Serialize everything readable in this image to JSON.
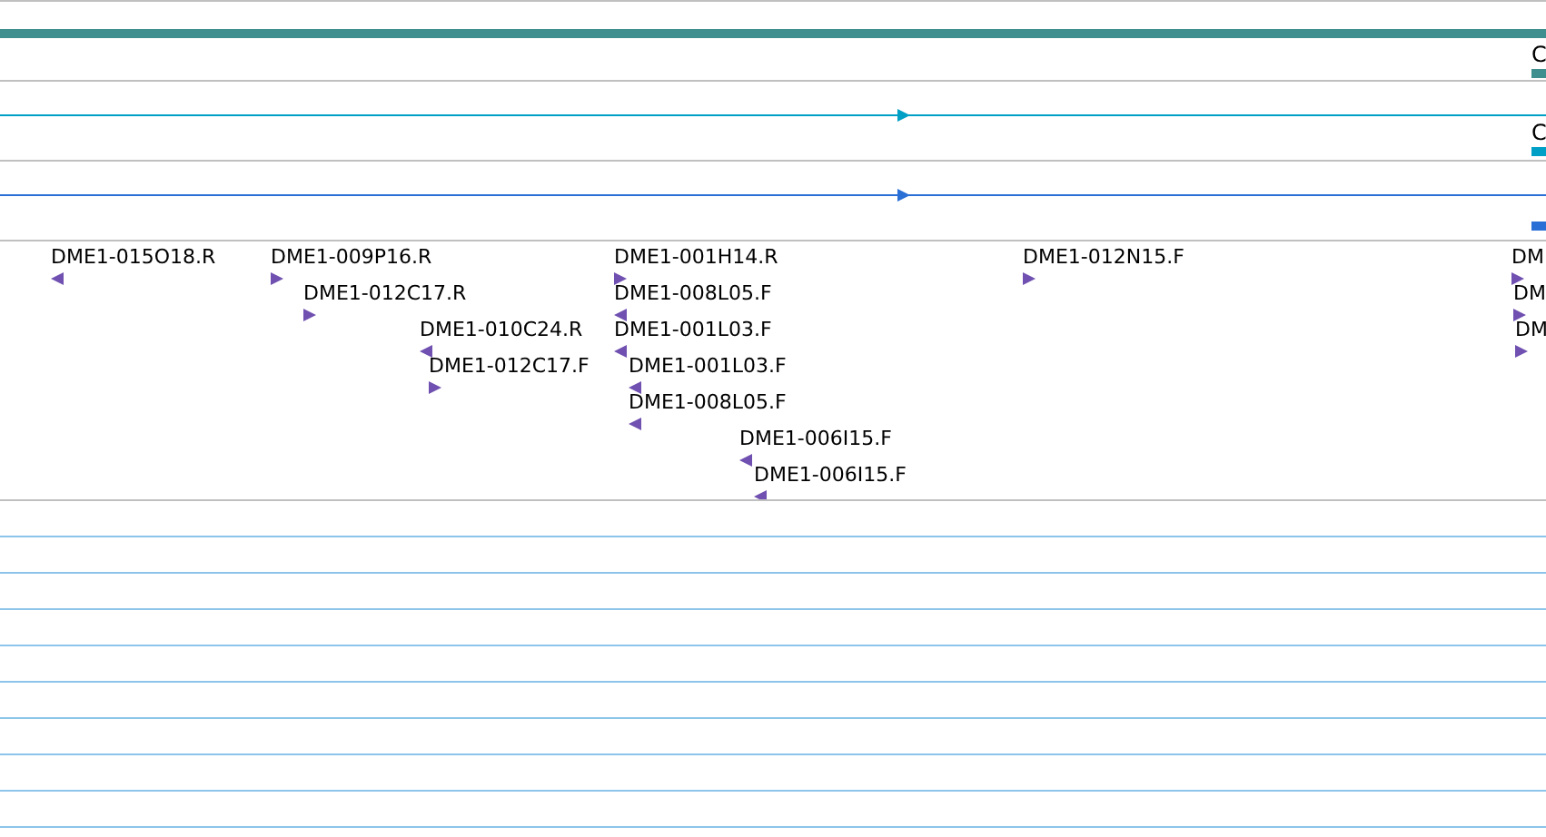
{
  "tracks": [
    {
      "kind": "bar",
      "color": "#3f8f8f",
      "label": "C"
    },
    {
      "kind": "line",
      "color": "#00a0c6",
      "label": "C"
    },
    {
      "kind": "line",
      "color": "#2a6fd6"
    }
  ],
  "features": [
    {
      "label": "DME1-015O18.R",
      "forward": false
    },
    {
      "label": "DME1-009P16.R",
      "forward": true
    },
    {
      "label": "DME1-012C17.R",
      "forward": true
    },
    {
      "label": "DME1-010C24.R",
      "forward": false
    },
    {
      "label": "DME1-012C17.F",
      "forward": true
    },
    {
      "label": "DME1-001H14.R",
      "forward": true
    },
    {
      "label": "DME1-008L05.F",
      "forward": false
    },
    {
      "label": "DME1-001L03.F",
      "forward": false
    },
    {
      "label": "DME1-001L03.F",
      "forward": false
    },
    {
      "label": "DME1-008L05.F",
      "forward": false
    },
    {
      "label": "DME1-006I15.F",
      "forward": false
    },
    {
      "label": "DME1-006I15.F",
      "forward": false
    },
    {
      "label": "DME1-012N15.F",
      "forward": true
    },
    {
      "label": "DM",
      "forward": true
    },
    {
      "label": "DM",
      "forward": true
    },
    {
      "label": "DM",
      "forward": true
    }
  ]
}
